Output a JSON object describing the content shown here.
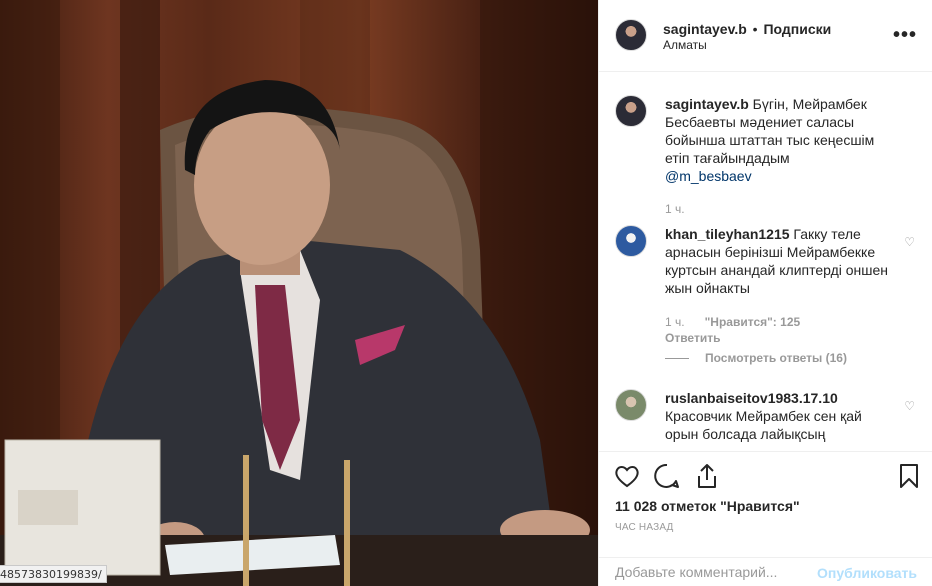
{
  "photo": {
    "status_url": "48573830199839/"
  },
  "post": {
    "author": "sagintayev.b",
    "separator": "•",
    "follow_label": "Подписки",
    "location": "Алматы",
    "more_label": "•••"
  },
  "caption": {
    "username": "sagintayev.b",
    "text": "Бүгін, Мейрамбек Бесбаевты мәдениет саласы бойынша штаттан тыс кеңесшім етіп тағайындадым",
    "mention": "@m_besbaev",
    "time": "1 ч."
  },
  "comments": [
    {
      "username": "khan_tileyhan1215",
      "text": "Гакку теле арнасын берiнiзшi Мейрамбекке куртсын анандай клиптерді оншен жын ойнакты",
      "time": "1 ч.",
      "likes_label": "\"Нравится\":",
      "likes_count": "125",
      "reply_label": "Ответить",
      "view_replies": "Посмотреть ответы (16)"
    },
    {
      "username": "ruslanbaiseitov1983.17.10",
      "text": "Красовчик Мейрамбек сен қай орын болсада лайықсың"
    }
  ],
  "footer": {
    "likes_text": "11 028 отметок \"Нравится\"",
    "time_ago": "ЧАС НАЗАД",
    "comment_placeholder": "Добавьте комментарий...",
    "publish_label": "Опубликовать"
  },
  "icons": {
    "like": "heart-icon",
    "comment": "comment-icon",
    "share": "share-icon",
    "save": "bookmark-icon"
  }
}
